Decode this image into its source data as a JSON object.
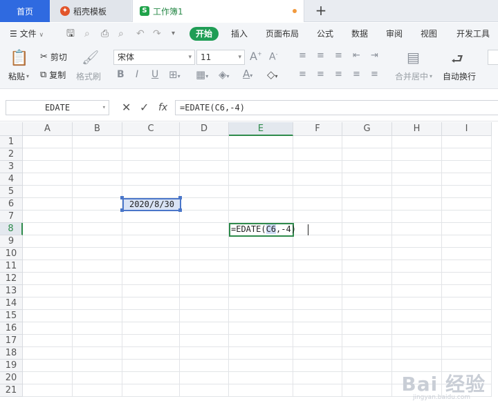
{
  "tabs": {
    "home": "首页",
    "template": "稻壳模板",
    "workbook": "工作簿1",
    "workbook_icon": "S"
  },
  "menu": {
    "file": "文件",
    "items": [
      "开始",
      "插入",
      "页面布局",
      "公式",
      "数据",
      "审阅",
      "视图",
      "开发工具"
    ]
  },
  "ribbon": {
    "paste": "粘贴",
    "cut": "剪切",
    "copy": "复制",
    "format_painter": "格式刷",
    "font_name": "宋体",
    "font_size": "11",
    "merge_center": "合并居中",
    "wrap_text": "自动换行",
    "bold": "B",
    "italic": "I",
    "underline": "U",
    "font_grow": "A",
    "font_shrink": "A",
    "font_color": "A"
  },
  "formula_bar": {
    "name_box": "EDATE",
    "fx": "fx",
    "formula": "=EDATE(C6,-4)"
  },
  "sheet": {
    "columns": [
      "A",
      "B",
      "C",
      "D",
      "E",
      "F",
      "G",
      "H",
      "I"
    ],
    "rows": [
      "1",
      "2",
      "3",
      "4",
      "5",
      "6",
      "7",
      "8",
      "9",
      "10",
      "11",
      "12",
      "13",
      "14",
      "15",
      "16",
      "17",
      "18",
      "19",
      "20",
      "21"
    ],
    "active_column": "E",
    "active_row": "8",
    "c6_value": "2020/8/30",
    "edit_prefix": "=EDATE(",
    "edit_ref": "C6",
    "edit_suffix": ",-4)"
  },
  "watermark": {
    "text": "Bai 经验",
    "url": "jingyan.baidu.com"
  },
  "colors": {
    "accent_blue": "#2f6ae0",
    "accent_green": "#1f9d55",
    "selection_blue": "#4a76c9"
  }
}
